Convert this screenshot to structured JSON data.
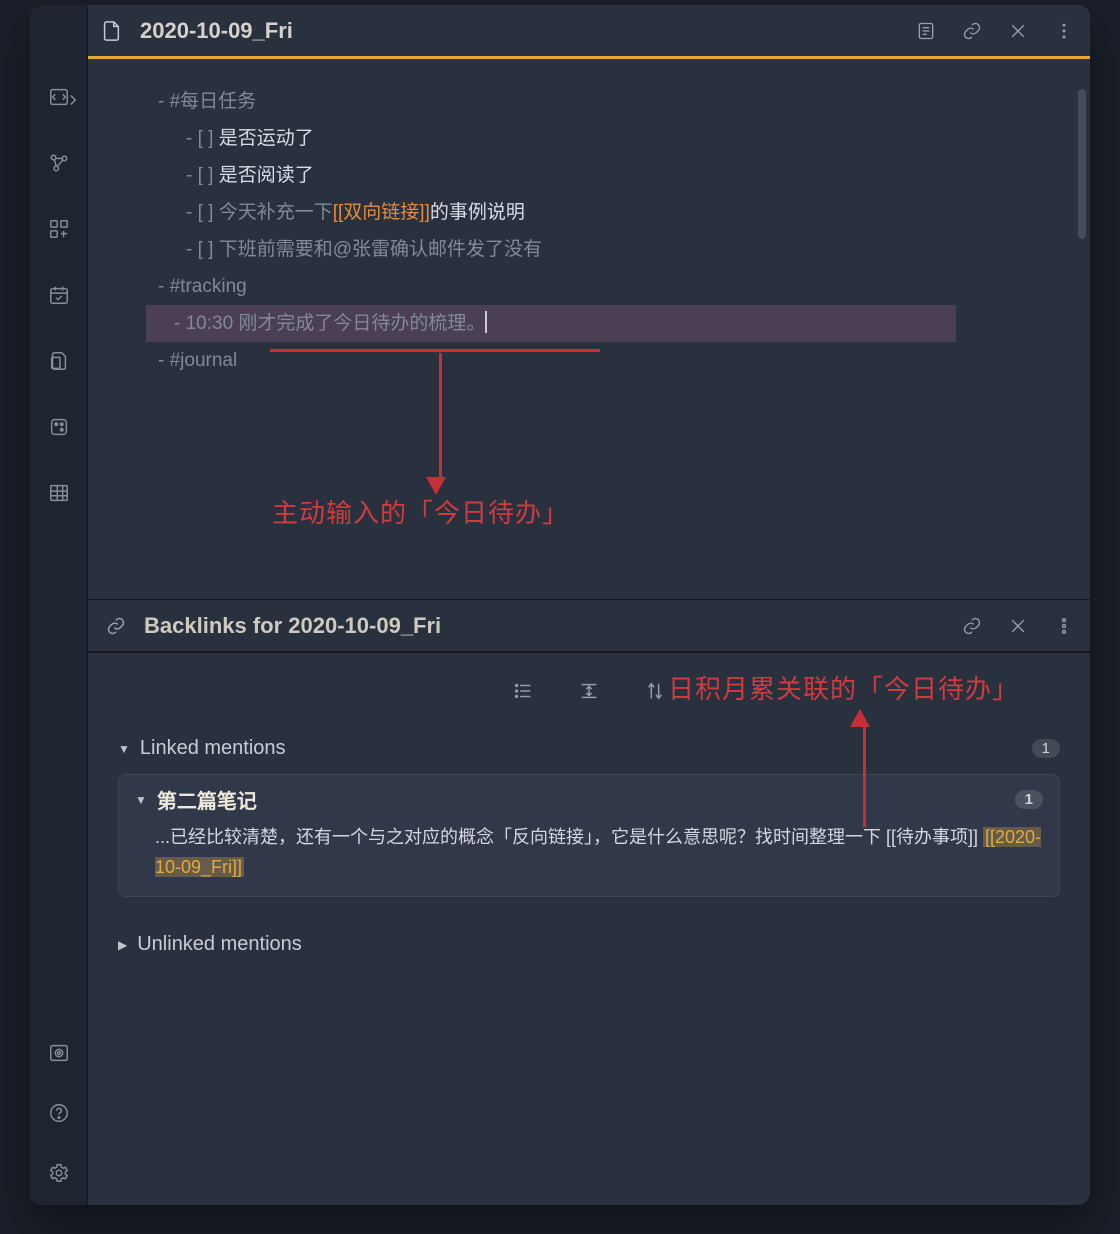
{
  "header": {
    "title": "2020-10-09_Fri"
  },
  "editor": {
    "tag1": "#每日任务",
    "tasks": [
      {
        "prefix": "- [ ] ",
        "text": "是否运动了"
      },
      {
        "prefix": "- [ ] ",
        "text": "是否阅读了"
      }
    ],
    "task3_pre": "- [ ] 今天补充一下",
    "task3_link": "[[双向链接]]",
    "task3_post": "的事例说明",
    "task4": "- [ ] 下班前需要和@张雷确认邮件发了没有",
    "tag2": "#tracking",
    "tracking_line": "- 10:30 刚才完成了今日待办的梳理。",
    "tag3": "#journal",
    "annotation1": "主动输入的「今日待办」"
  },
  "backlinks": {
    "title": "Backlinks for 2020-10-09_Fri",
    "annotation2": "日积月累关联的「今日待办」",
    "linked_label": "Linked mentions",
    "linked_count": "1",
    "result_title": "第二篇笔记",
    "result_count": "1",
    "result_text_pre": "...已经比较清楚，还有一个与之对应的概念「反向链接」，它是什么意思呢？找时间整理一下 [[待办事项]] ",
    "result_highlight": "[[2020-10-09_Fri]]",
    "unlinked_label": "Unlinked mentions"
  }
}
